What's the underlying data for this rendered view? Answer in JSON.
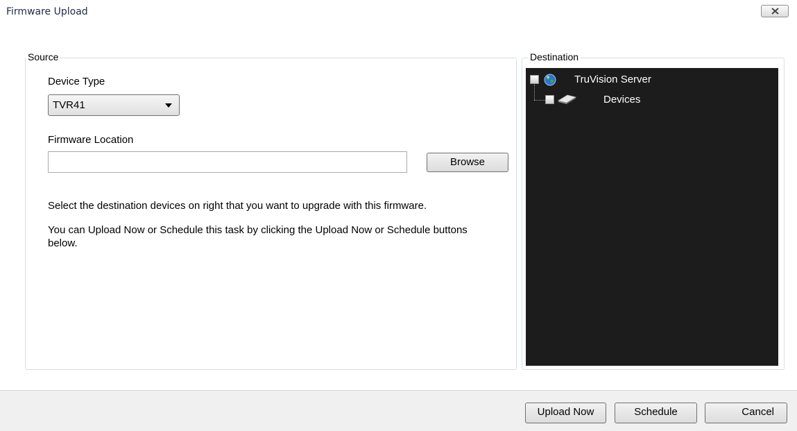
{
  "window": {
    "title": "Firmware Upload",
    "close_icon": "close-x-icon"
  },
  "source": {
    "legend": "Source",
    "device_type_label": "Device Type",
    "device_type_value": "TVR41",
    "firmware_location_label": "Firmware Location",
    "firmware_location_value": "",
    "browse_label": "Browse",
    "instruction_1": "Select the destination devices on right that you want to upgrade with this firmware.",
    "instruction_2": "You can Upload Now or Schedule this task by clicking the Upload Now or Schedule buttons below."
  },
  "destination": {
    "legend": "Destination",
    "tree": [
      {
        "label": "TruVision Server",
        "icon": "globe-icon",
        "checked": false,
        "level": 0
      },
      {
        "label": "Devices",
        "icon": "device-icon",
        "checked": false,
        "level": 1
      }
    ]
  },
  "footer": {
    "upload_now_label": "Upload Now",
    "schedule_label": "Schedule",
    "cancel_label": "Cancel"
  },
  "colors": {
    "tree_background": "#1c1c1c",
    "footer_background": "#f0f0f0",
    "title_text": "#1e2a44"
  }
}
